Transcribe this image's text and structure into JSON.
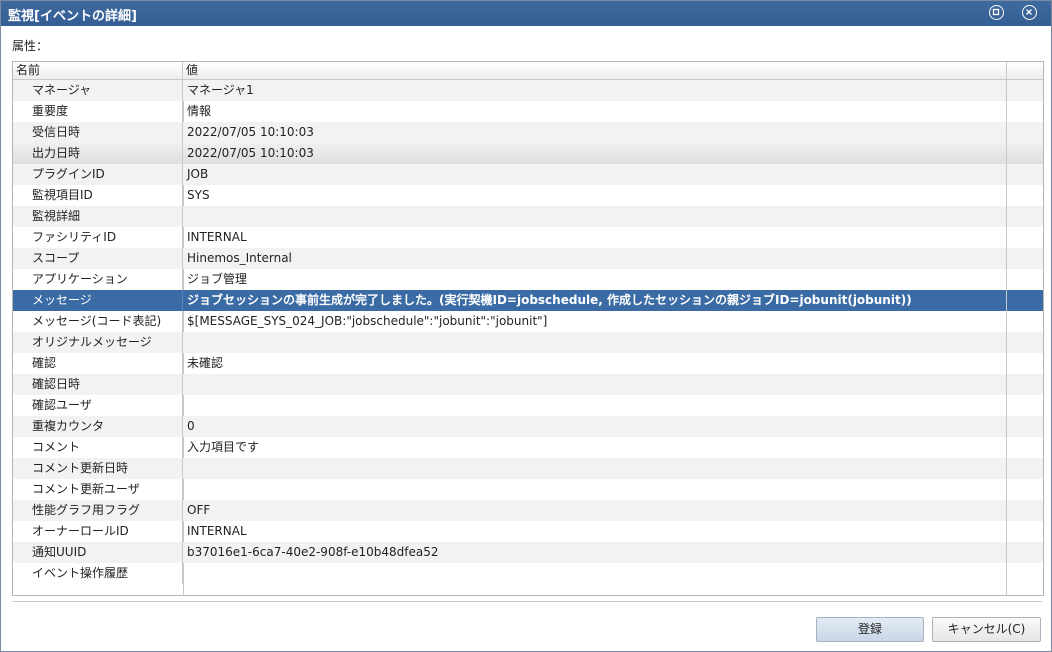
{
  "window": {
    "title": "監視[イベントの詳細]"
  },
  "attributes_label": "属性：",
  "table": {
    "columns": [
      "名前",
      "値",
      ""
    ],
    "rows": [
      {
        "name": "マネージャ",
        "value": "マネージャ1"
      },
      {
        "name": "重要度",
        "value": "情報"
      },
      {
        "name": "受信日時",
        "value": "2022/07/05 10:10:03"
      },
      {
        "name": "出力日時",
        "value": "2022/07/05 10:10:03"
      },
      {
        "name": "プラグインID",
        "value": "JOB"
      },
      {
        "name": "監視項目ID",
        "value": "SYS"
      },
      {
        "name": "監視詳細",
        "value": ""
      },
      {
        "name": "ファシリティID",
        "value": "INTERNAL"
      },
      {
        "name": "スコープ",
        "value": "Hinemos_Internal"
      },
      {
        "name": "アプリケーション",
        "value": "ジョブ管理"
      },
      {
        "name": "メッセージ",
        "value": "ジョブセッションの事前生成が完了しました。(実行契機ID=jobschedule, 作成したセッションの親ジョブID=jobunit(jobunit))"
      },
      {
        "name": "メッセージ(コード表記)",
        "value": "$[MESSAGE_SYS_024_JOB:\"jobschedule\":\"jobunit\":\"jobunit\"]"
      },
      {
        "name": "オリジナルメッセージ",
        "value": ""
      },
      {
        "name": "確認",
        "value": "未確認"
      },
      {
        "name": "確認日時",
        "value": ""
      },
      {
        "name": "確認ユーザ",
        "value": ""
      },
      {
        "name": "重複カウンタ",
        "value": "0"
      },
      {
        "name": "コメント",
        "value": "入力項目です"
      },
      {
        "name": "コメント更新日時",
        "value": ""
      },
      {
        "name": "コメント更新ユーザ",
        "value": ""
      },
      {
        "name": "性能グラフ用フラグ",
        "value": "OFF"
      },
      {
        "name": "オーナーロールID",
        "value": "INTERNAL"
      },
      {
        "name": "通知UUID",
        "value": "b37016e1-6ca7-40e2-908f-e10b48dfea52"
      },
      {
        "name": "イベント操作履歴",
        "value": ""
      }
    ]
  },
  "buttons": {
    "register": "登録",
    "cancel": "キャンセル(C)"
  },
  "colors": {
    "titlebar": "#3f6aa0",
    "selected_row": "#3b6ba5"
  }
}
